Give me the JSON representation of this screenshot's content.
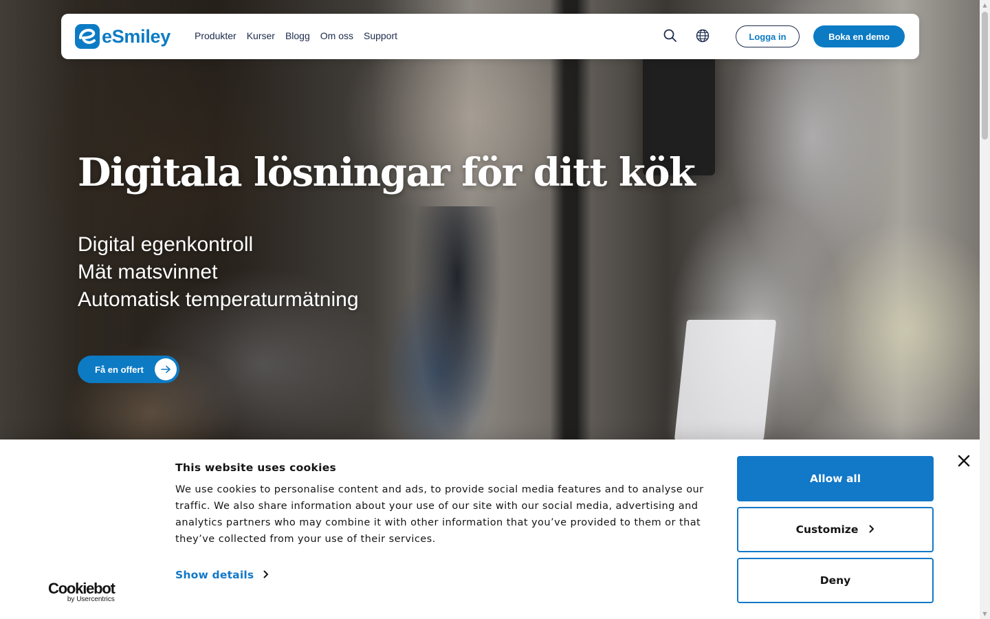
{
  "header": {
    "logo_text": "eSmiley",
    "nav": [
      "Produkter",
      "Kurser",
      "Blogg",
      "Om oss",
      "Support"
    ],
    "login_label": "Logga in",
    "demo_label": "Boka en demo"
  },
  "hero": {
    "title": "Digitala lösningar för ditt kök",
    "lines": [
      "Digital egenkontroll",
      "Mät matsvinnet",
      "Automatisk temperaturmätning"
    ],
    "cta_label": "Få en offert"
  },
  "cookie_banner": {
    "title": "This website uses cookies",
    "text": "We use cookies to personalise content and ads, to provide social media features and to analyse our traffic. We also share information about your use of our site with our social media, advertising and analytics partners who may combine it with other information that you’ve provided to them or that they’ve collected from your use of their services.",
    "show_details": "Show details",
    "allow_all": "Allow all",
    "customize": "Customize",
    "deny": "Deny",
    "brand": "Cookiebot",
    "brand_sub": "by Usercentrics"
  },
  "colors": {
    "accent": "#0d7bc4",
    "cookie_accent": "#1278c8",
    "nav_text": "#1b2a4a"
  },
  "icons": [
    "search-icon",
    "globe-icon",
    "arrow-right-icon",
    "close-icon",
    "chevron-right-icon"
  ]
}
